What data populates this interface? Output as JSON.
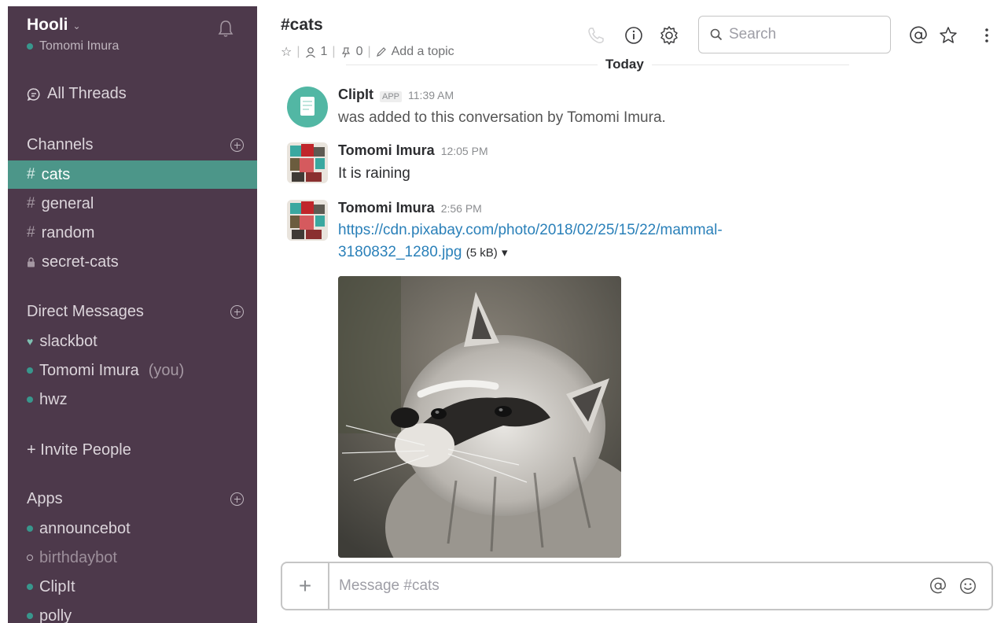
{
  "team": {
    "name": "Hooli",
    "user": "Tomomi Imura"
  },
  "sidebar": {
    "all_threads": "All Threads",
    "channels_label": "Channels",
    "channels": [
      {
        "prefix": "#",
        "name": "cats",
        "active": true
      },
      {
        "prefix": "#",
        "name": "general"
      },
      {
        "prefix": "#",
        "name": "random"
      },
      {
        "prefix": "lock",
        "name": "secret-cats"
      }
    ],
    "dm_label": "Direct Messages",
    "dms": [
      {
        "name": "slackbot",
        "status": "heart"
      },
      {
        "name": "Tomomi Imura",
        "suffix": "(you)",
        "status": "online"
      },
      {
        "name": "hwz",
        "status": "online"
      }
    ],
    "invite": "+ Invite People",
    "apps_label": "Apps",
    "apps": [
      {
        "name": "announcebot",
        "status": "online"
      },
      {
        "name": "birthdaybot",
        "status": "away"
      },
      {
        "name": "ClipIt",
        "status": "online"
      },
      {
        "name": "polly",
        "status": "online"
      }
    ]
  },
  "header": {
    "channel": "#cats",
    "members": "1",
    "pins": "0",
    "add_topic": "Add a topic",
    "search_placeholder": "Search",
    "day_divider": "Today"
  },
  "messages": [
    {
      "author": "ClipIt",
      "badge": "APP",
      "time": "11:39 AM",
      "text": "was added to this conversation by Tomomi Imura."
    },
    {
      "author": "Tomomi Imura",
      "time": "12:05 PM",
      "text": "It is raining"
    },
    {
      "author": "Tomomi Imura",
      "time": "2:56 PM",
      "link_line1": "https://cdn.pixabay.com/photo/2018/02/25/15/22/mammal-",
      "link_line2": "3180832_1280.jpg",
      "size": "(5 kB)"
    }
  ],
  "composer": {
    "placeholder": "Message #cats"
  },
  "colors": {
    "sidebar": "#4d394b",
    "active": "#4c9689",
    "link": "#2a80b9",
    "online": "#38978d"
  }
}
